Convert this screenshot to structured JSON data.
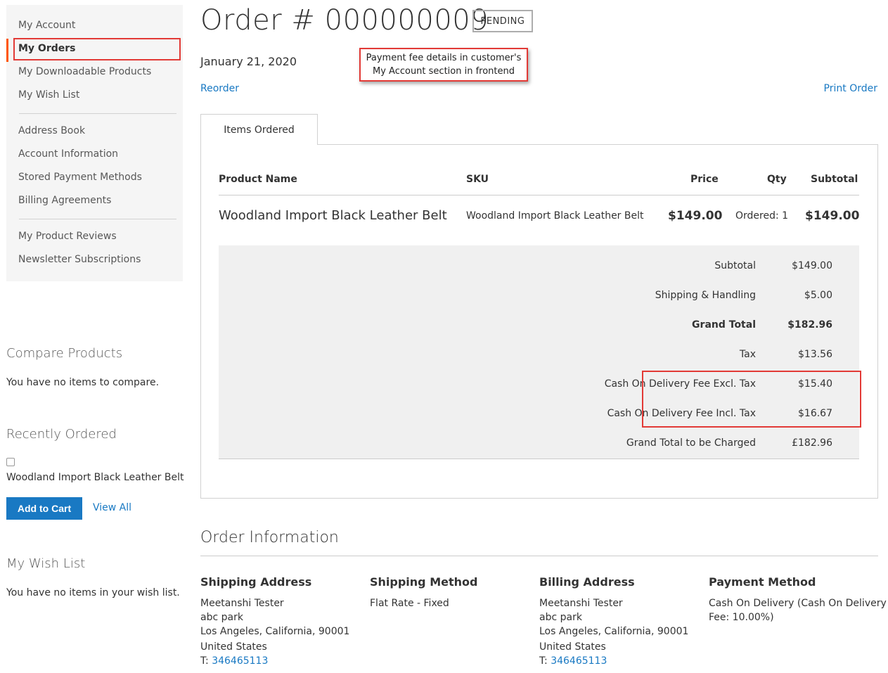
{
  "sidebar": {
    "account_nav": [
      {
        "label": "My Account"
      },
      {
        "label": "My Orders"
      },
      {
        "label": "My Downloadable Products"
      },
      {
        "label": "My Wish List"
      },
      {
        "label": "Address Book"
      },
      {
        "label": "Account Information"
      },
      {
        "label": "Stored Payment Methods"
      },
      {
        "label": "Billing Agreements"
      },
      {
        "label": "My Product Reviews"
      },
      {
        "label": "Newsletter Subscriptions"
      }
    ],
    "active_item": "My Orders",
    "compare": {
      "title": "Compare Products",
      "empty": "You have no items to compare."
    },
    "recently_ordered": {
      "title": "Recently Ordered",
      "item": "Woodland Import Black Leather Belt",
      "add_to_cart": "Add to Cart",
      "view_all": "View All"
    },
    "wishlist": {
      "title": "My Wish List",
      "empty": "You have no items in your wish list."
    }
  },
  "order": {
    "title": "Order # 000000009",
    "status": "PENDING",
    "date": "January 21, 2020",
    "reorder": "Reorder",
    "print": "Print Order"
  },
  "callout": {
    "line1": "Payment fee details in customer's",
    "line2": "My Account section in frontend"
  },
  "tab": {
    "label": "Items Ordered"
  },
  "table": {
    "headers": {
      "product": "Product Name",
      "sku": "SKU",
      "price": "Price",
      "qty": "Qty",
      "subtotal": "Subtotal"
    },
    "row": {
      "product": "Woodland Import Black Leather Belt",
      "sku": "Woodland Import Black Leather Belt",
      "price": "$149.00",
      "qty": "Ordered: 1",
      "subtotal": "$149.00"
    }
  },
  "totals": [
    {
      "label": "Subtotal",
      "value": "$149.00",
      "bold": false
    },
    {
      "label": "Shipping & Handling",
      "value": "$5.00",
      "bold": false
    },
    {
      "label": "Grand Total",
      "value": "$182.96",
      "bold": true
    },
    {
      "label": "Tax",
      "value": "$13.56",
      "bold": false
    },
    {
      "label": "Cash On Delivery Fee Excl. Tax",
      "value": "$15.40",
      "bold": false
    },
    {
      "label": "Cash On Delivery Fee Incl. Tax",
      "value": "$16.67",
      "bold": false
    },
    {
      "label": "Grand Total to be Charged",
      "value": "£182.96",
      "bold": false
    }
  ],
  "order_info": {
    "title": "Order Information",
    "shipping_address": {
      "title": "Shipping Address",
      "name": "Meetanshi Tester",
      "street": "abc park",
      "city": "Los Angeles, California, 90001",
      "country": "United States",
      "phone_prefix": "T:",
      "phone": "346465113"
    },
    "shipping_method": {
      "title": "Shipping Method",
      "value": "Flat Rate - Fixed"
    },
    "billing_address": {
      "title": "Billing Address",
      "name": "Meetanshi Tester",
      "street": "abc park",
      "city": "Los Angeles, California, 90001",
      "country": "United States",
      "phone_prefix": "T:",
      "phone": "346465113"
    },
    "payment_method": {
      "title": "Payment Method",
      "line1": "Cash On Delivery (Cash On Delivery",
      "line2": "Fee: 10.00%)"
    }
  },
  "colors": {
    "link": "#1979c3",
    "highlight": "#e23a36",
    "active_bar": "#ff5501",
    "button": "#1979c3"
  }
}
